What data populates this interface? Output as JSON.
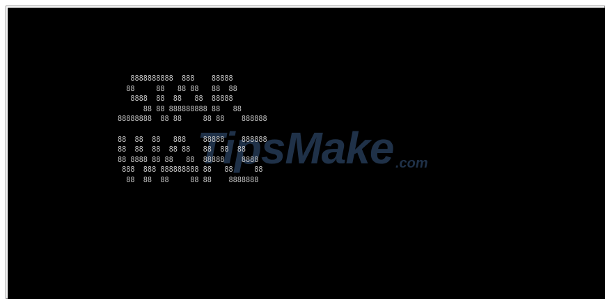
{
  "console": {
    "ascii_lines": [
      "   8888888888  888    88888",
      "  88     88   88 88   88  88",
      "   8888  88  88   88  88888",
      "      88 88 888888888 88   88",
      "88888888  88 88     88 88    888888",
      "",
      "88  88  88   888    88888    888888",
      "88  88  88  88 88   88  88  88",
      "88 8888 88 88   88  88888    8888",
      " 888  888 888888888 88   88     88",
      "  88  88  88     88 88    8888888"
    ]
  },
  "watermark": {
    "main": "TipsMake",
    "suffix": ".com"
  }
}
